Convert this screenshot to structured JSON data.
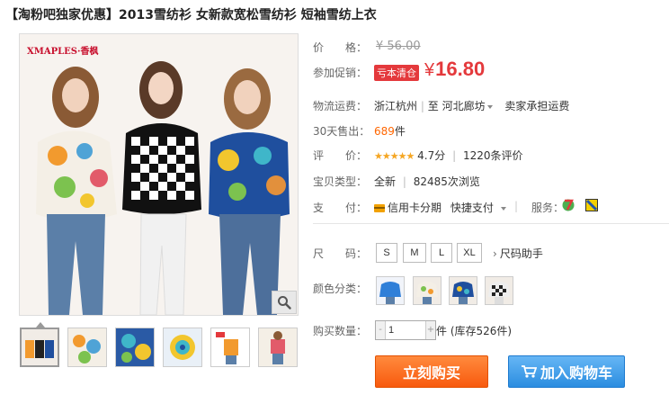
{
  "title": "【淘粉吧独家优惠】2013雪纺衫 女新款宽松雪纺衫 短袖雪纺上衣",
  "main_image": {
    "brand": "XMAPLES·香枫"
  },
  "thumbnails": [
    "thumb-1",
    "thumb-2",
    "thumb-3",
    "thumb-4",
    "thumb-5",
    "thumb-6"
  ],
  "price": {
    "label": "价　　格：",
    "original": "¥ 56.00"
  },
  "promo": {
    "label": "参加促销：",
    "tag": "亏本清仓",
    "currency": "¥",
    "price": "16.80"
  },
  "shipping": {
    "label": "物流运费：",
    "from": "浙江杭州",
    "sep": "|",
    "to_prefix": "至",
    "to": "河北廊坊",
    "fee": "卖家承担运费"
  },
  "sales": {
    "label": "30天售出：",
    "count": "689",
    "unit": "件"
  },
  "rating": {
    "label": "评　　价：",
    "stars": "★★★★★",
    "score": "4.7分",
    "sep": "|",
    "reviews": "1220条评价"
  },
  "item_type": {
    "label": "宝贝类型：",
    "value": "全新",
    "sep": "|",
    "views": "82485次浏览"
  },
  "payment": {
    "label": "支　　付：",
    "credit": "信用卡分期",
    "quick": "快捷支付",
    "service_label": "服务："
  },
  "size": {
    "label": "尺　　码：",
    "options": [
      "S",
      "M",
      "L",
      "XL"
    ],
    "helper": "尺码助手"
  },
  "color": {
    "label": "颜色分类："
  },
  "quantity": {
    "label": "购买数量：",
    "minus": "-",
    "plus": "+",
    "value": "1",
    "stock": "件 (库存526件)"
  },
  "actions": {
    "buy": "立刻购买",
    "cart": "加入购物车"
  }
}
